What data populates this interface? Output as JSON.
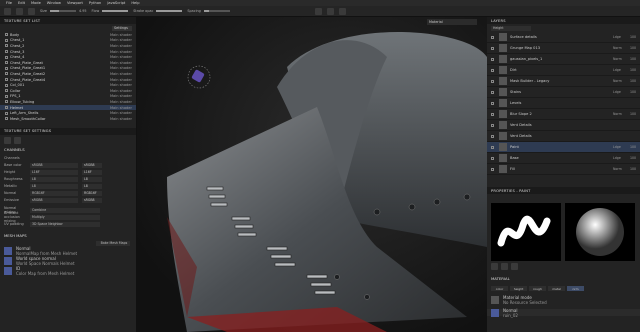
{
  "menu": [
    "File",
    "Edit",
    "Mode",
    "Window",
    "Viewport",
    "Python",
    "JavaScript",
    "Help"
  ],
  "toolbar": {
    "size_label": "Size",
    "size_value": "4.95",
    "flow_label": "Flow",
    "stroke_opacity_label": "Stroke opac",
    "spacing_label": "Spacing",
    "size_fill": 0.35,
    "flow_fill": 1.0,
    "stroke_opacity_fill": 1.0,
    "spacing_fill": 0.2
  },
  "texture_set_list": {
    "title": "TEXTURE SET LIST",
    "settings_label": "Settings",
    "items": [
      {
        "name": "Body",
        "shader": "Main shader"
      },
      {
        "name": "Chest_1",
        "shader": "Main shader"
      },
      {
        "name": "Chest_2",
        "shader": "Main shader"
      },
      {
        "name": "Chest_3",
        "shader": "Main shader"
      },
      {
        "name": "Chest_4",
        "shader": "Main shader"
      },
      {
        "name": "Chest_Plate_Great",
        "shader": "Main shader"
      },
      {
        "name": "Chest_Plate_Great1",
        "shader": "Main shader"
      },
      {
        "name": "Chest_Plate_Great2",
        "shader": "Main shader"
      },
      {
        "name": "Chest_Plate_Great4",
        "shader": "Main shader"
      },
      {
        "name": "Col_001",
        "shader": "Main shader"
      },
      {
        "name": "Collar",
        "shader": "Main shader"
      },
      {
        "name": "FPS_1",
        "shader": "Main shader"
      },
      {
        "name": "Elbow_Tubing",
        "shader": "Main shader"
      },
      {
        "name": "Helmet",
        "shader": "Main shader"
      },
      {
        "name": "Left_Arm_Shells",
        "shader": "Main shader"
      },
      {
        "name": "Mesh_SmoothCollar",
        "shader": "Main shader"
      }
    ]
  },
  "texture_set_settings": {
    "title": "TEXTURE SET SETTINGS",
    "channels_title": "CHANNELS",
    "channels_sub": "Channels",
    "channels": [
      {
        "label": "Base color",
        "value": "sRGB8",
        "fmt": "sRGB8"
      },
      {
        "label": "Height",
        "value": "L16F",
        "fmt": "L16F"
      },
      {
        "label": "Roughness",
        "value": "L8",
        "fmt": "L8"
      },
      {
        "label": "Metallic",
        "value": "L8",
        "fmt": "L8"
      },
      {
        "label": "Normal",
        "value": "RGB16F",
        "fmt": "RGB16F"
      },
      {
        "label": "Emissive",
        "value": "sRGB8",
        "fmt": "sRGB8"
      }
    ],
    "normal_mixing_label": "Normal mixing",
    "normal_mixing_value": "Combine",
    "ao_mixing_label": "Ambient occlusion mixing",
    "ao_mixing_value": "Multiply",
    "uv_padding_label": "UV padding",
    "uv_padding_value": "3D Space Neighbor",
    "mesh_maps_title": "MESH MAPS",
    "bake_button": "Bake Mesh Maps",
    "maps": [
      {
        "name": "Normal",
        "sub": "NormalMap from Mesh Helmet"
      },
      {
        "name": "World space normal",
        "sub": "World Space Normals Helmet"
      },
      {
        "name": "ID",
        "sub": "Color Map from Mesh Helmet"
      }
    ]
  },
  "viewport": {
    "material_dropdown": "Material"
  },
  "layers": {
    "title": "LAYERS",
    "blend_dropdown": "Height",
    "items": [
      {
        "name": "Surface details",
        "blend": "Ldge",
        "opacity": "100"
      },
      {
        "name": "Grunge Map 013",
        "blend": "Norm",
        "opacity": "100"
      },
      {
        "name": "gaussian_pixels_1",
        "blend": "Norm",
        "opacity": "100"
      },
      {
        "name": "Dirt",
        "blend": "Ldge",
        "opacity": "100"
      },
      {
        "name": "Mask Builder - Legacy",
        "blend": "Norm",
        "opacity": "100"
      },
      {
        "name": "Stains",
        "blend": "Ldge",
        "opacity": "100"
      },
      {
        "name": "Levels",
        "blend": "",
        "opacity": ""
      },
      {
        "name": "Blur Slope 2",
        "blend": "Norm",
        "opacity": "100"
      },
      {
        "name": "Vent Details",
        "blend": "",
        "opacity": ""
      },
      {
        "name": "Vent Details",
        "blend": "",
        "opacity": ""
      },
      {
        "name": "Paint",
        "blend": "Ldge",
        "opacity": "100"
      },
      {
        "name": "Base",
        "blend": "Ldge",
        "opacity": "100"
      },
      {
        "name": "Fill",
        "blend": "Norm",
        "opacity": "100"
      }
    ]
  },
  "properties": {
    "title": "PROPERTIES - PAINT",
    "material_title": "MATERIAL",
    "tabs": [
      "color",
      "height",
      "rough",
      "metal",
      "nrm"
    ],
    "active_tab": 4,
    "material_mode_label": "Material mode",
    "material_mode_value": "No Resource Selected",
    "normal_label": "Normal",
    "normal_value": "ruin_02"
  },
  "colors": {
    "accent": "#3d4b66",
    "panel": "#232323",
    "selected_row": "#2e3b52",
    "paint_red": "#8a1f1f"
  }
}
